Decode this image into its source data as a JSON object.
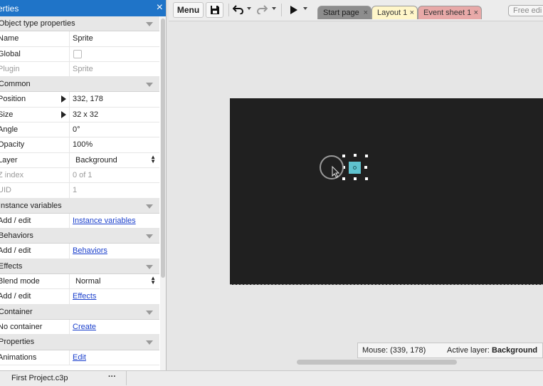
{
  "properties_panel": {
    "title": "erties",
    "close_glyph": "×",
    "rows": [
      {
        "type": "section",
        "name": "Object type properties"
      },
      {
        "type": "prop",
        "name": "Name",
        "value": "Sprite"
      },
      {
        "type": "checkbox",
        "name": "Global",
        "checked": false
      },
      {
        "type": "prop",
        "name": "Plugin",
        "value": "Sprite",
        "disabled": true
      },
      {
        "type": "section",
        "name": "Common"
      },
      {
        "type": "prop",
        "name": "Position",
        "value": "332, 178",
        "expandable": true
      },
      {
        "type": "prop",
        "name": "Size",
        "value": "32 x 32",
        "expandable": true
      },
      {
        "type": "prop",
        "name": "Angle",
        "value": "0°"
      },
      {
        "type": "prop",
        "name": "Opacity",
        "value": "100%"
      },
      {
        "type": "dropdown",
        "name": "Layer",
        "value": "Background"
      },
      {
        "type": "prop",
        "name": "Z index",
        "value": "0 of 1",
        "disabled": true
      },
      {
        "type": "prop",
        "name": "UID",
        "value": "1",
        "disabled": true
      },
      {
        "type": "section",
        "name": "Instance variables"
      },
      {
        "type": "link",
        "name": "Add / edit",
        "value": "Instance variables"
      },
      {
        "type": "section",
        "name": "Behaviors"
      },
      {
        "type": "link",
        "name": "Add / edit",
        "value": "Behaviors"
      },
      {
        "type": "section",
        "name": "Effects"
      },
      {
        "type": "dropdown",
        "name": "Blend mode",
        "value": "Normal"
      },
      {
        "type": "link",
        "name": "Add / edit",
        "value": "Effects"
      },
      {
        "type": "section",
        "name": "Container"
      },
      {
        "type": "link",
        "name": "No container",
        "value": "Create"
      },
      {
        "type": "section",
        "name": "Properties"
      },
      {
        "type": "link",
        "name": "Animations",
        "value": "Edit"
      }
    ]
  },
  "toolbar": {
    "menu_label": "Menu",
    "save_icon": "save-icon",
    "undo_icon": "undo-icon",
    "redo_icon": "redo-icon",
    "play_icon": "play-icon",
    "tabs": [
      {
        "label": "Start page",
        "color": "#8d8d8d"
      },
      {
        "label": "Layout 1",
        "color": "#fff6c9"
      },
      {
        "label": "Event sheet 1",
        "color": "#e8a9a8"
      }
    ],
    "tab_close_glyph": "×",
    "free_edit_label": "Free edi"
  },
  "layout_view": {
    "canvas_color": "#202020",
    "sprite_color": "#5fc3cf"
  },
  "status_bar": {
    "mouse_text": "Mouse: (339, 178)",
    "active_layer_label": "Active layer: ",
    "active_layer_value": "Background"
  },
  "bottom_bar": {
    "project_name": "First Project.c3p",
    "more_glyph": "···"
  },
  "colors": {
    "panel_title_bg": "#1f74c8",
    "link": "#1a3fcc"
  }
}
